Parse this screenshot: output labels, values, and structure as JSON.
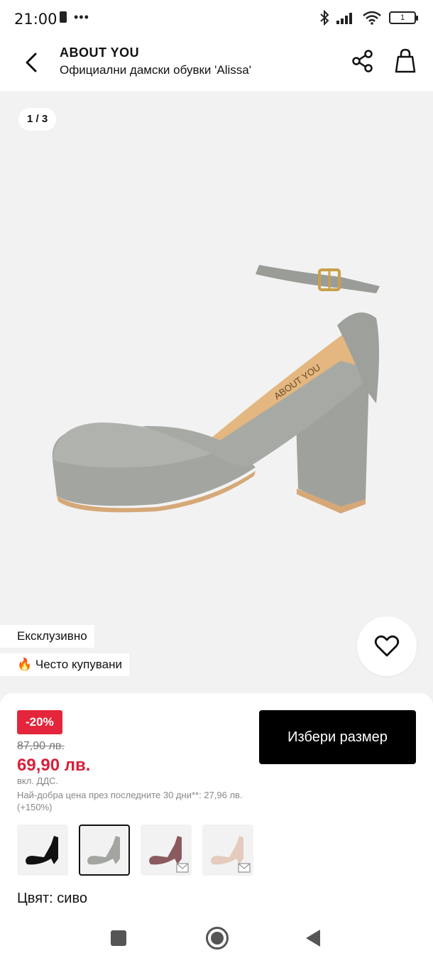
{
  "status_bar": {
    "time": "21:00",
    "dots": "•••",
    "battery": "1"
  },
  "header": {
    "brand": "ABOUT YOU",
    "product_title": "Официални дамски обувки 'Alissa'",
    "icons": [
      "chevron-left-icon",
      "share-icon",
      "shopping-bag-icon"
    ]
  },
  "gallery": {
    "counter": "1 / 3",
    "badges": [
      {
        "label": "Ексклузивно"
      },
      {
        "label": "🔥 Често купувани"
      }
    ],
    "insole_brand": "ABOUT YOU",
    "shoe_color": "#a3a5a1"
  },
  "purchase": {
    "discount": "-20%",
    "old_price": "87,90 лв.",
    "new_price": "69,90 лв.",
    "vat_note": "вкл. ДДС.",
    "best_price_note": "Най-добра цена през последните 30 дни**: 27,96 лв. (+150%)",
    "select_size_label": "Избери размер",
    "variants": [
      {
        "color": "#111111",
        "selected": false,
        "notify": false
      },
      {
        "color": "#a3a5a1",
        "selected": true,
        "notify": false
      },
      {
        "color": "#8a5a5e",
        "selected": false,
        "notify": true
      },
      {
        "color": "#e4cbbd",
        "selected": false,
        "notify": true
      }
    ],
    "color_label": "Цвят: сиво"
  },
  "colors": {
    "accent_red": "#e4253b",
    "price_red": "#d8203a",
    "button_black": "#000000",
    "gallery_bg": "#f2f2f2"
  }
}
